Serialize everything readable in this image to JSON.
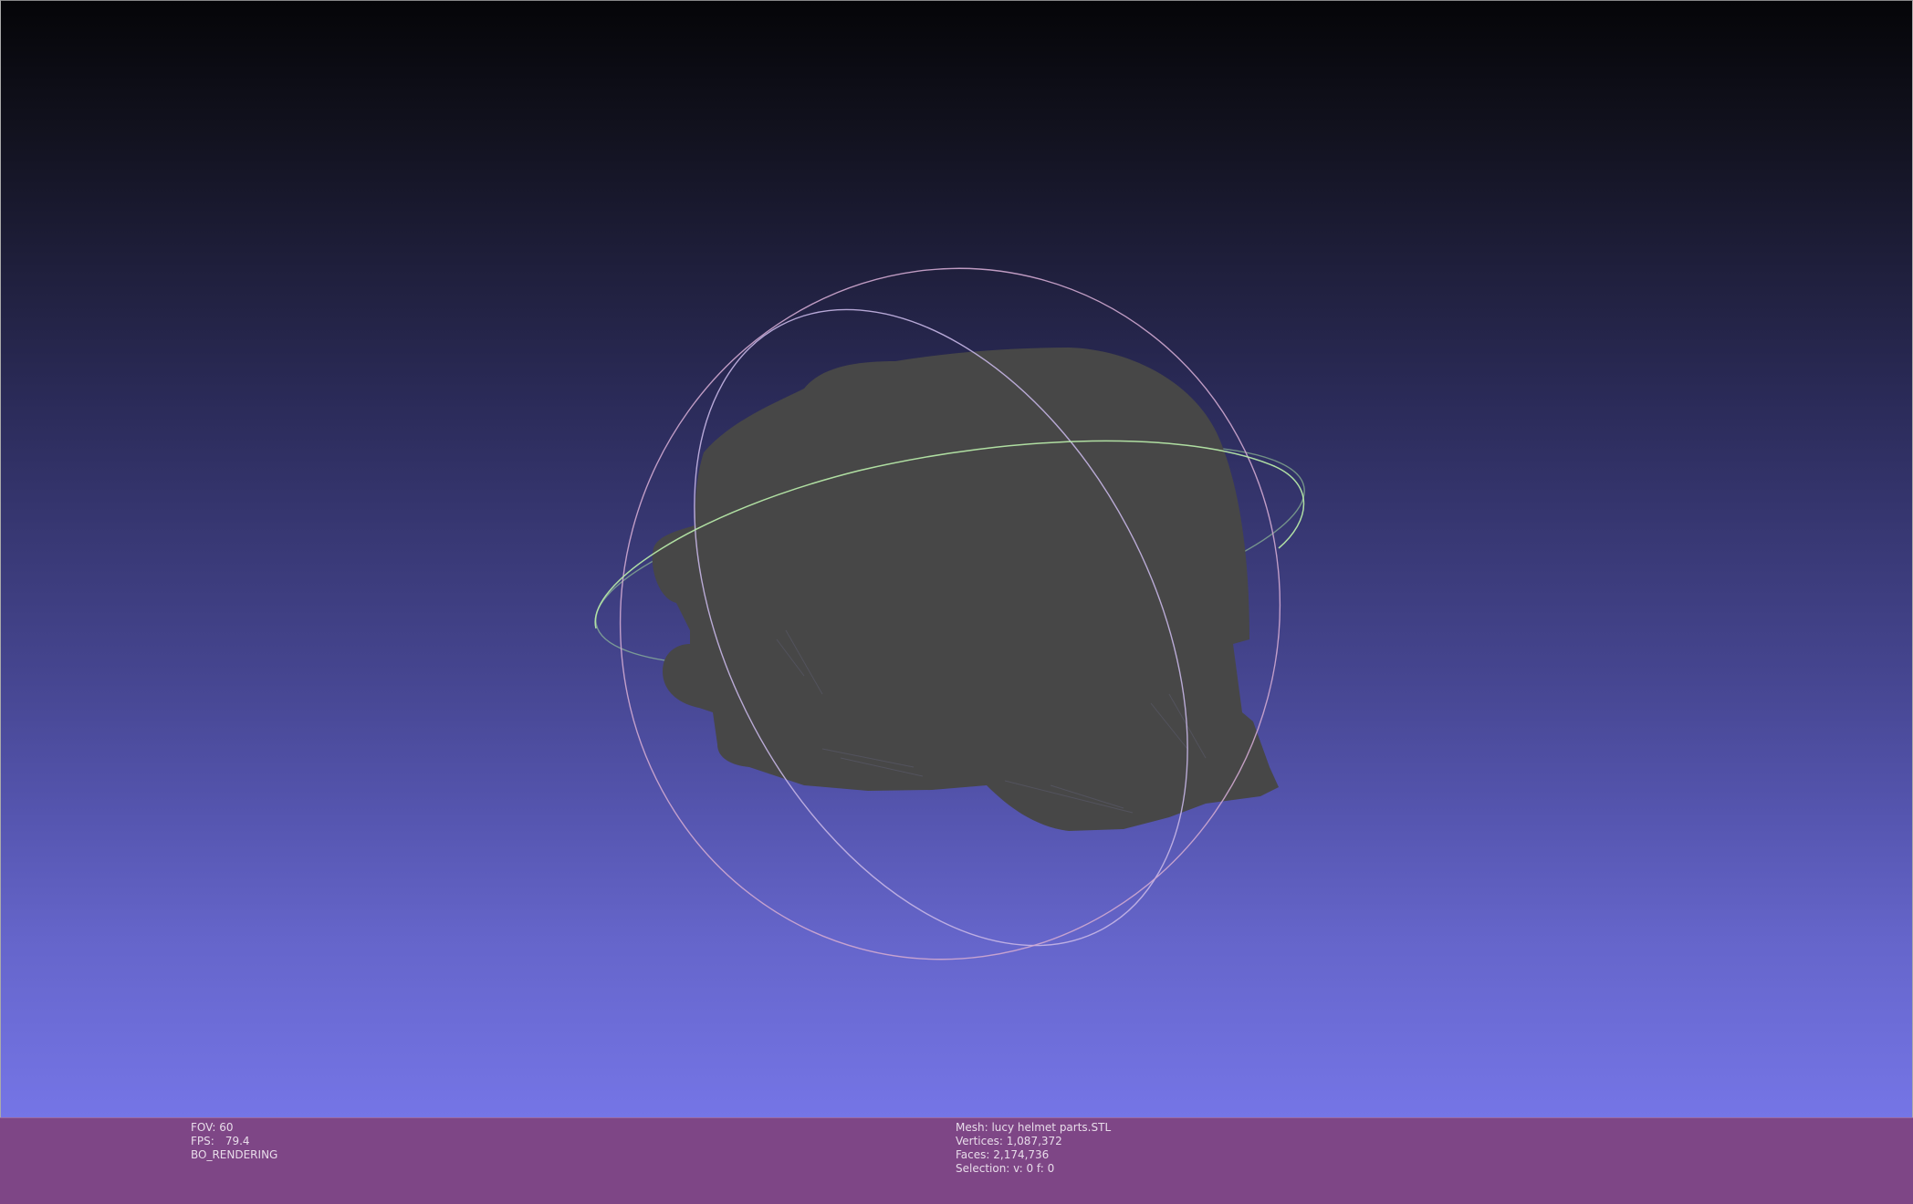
{
  "viewer": {
    "background_top": "#050508",
    "background_bottom": "#7575e6",
    "mesh_color": "#474747",
    "trackball_colors": {
      "ring_horizontal": "#a8e0a0",
      "ring_vertical_a": "#c6b6e6",
      "ring_vertical_b": "#d0a8d0"
    }
  },
  "info_bar": {
    "color": "#7e4686",
    "left": {
      "fov_text": "FOV: 60",
      "fps_label": "FPS:",
      "fps_value": "79.4",
      "render_mode": "BO_RENDERING"
    },
    "right": {
      "mesh_text": "Mesh: lucy helmet parts.STL",
      "vertices_text": "Vertices: 1,087,372",
      "faces_text": "Faces: 2,174,736",
      "selection_text": "Selection: v: 0 f: 0"
    }
  }
}
